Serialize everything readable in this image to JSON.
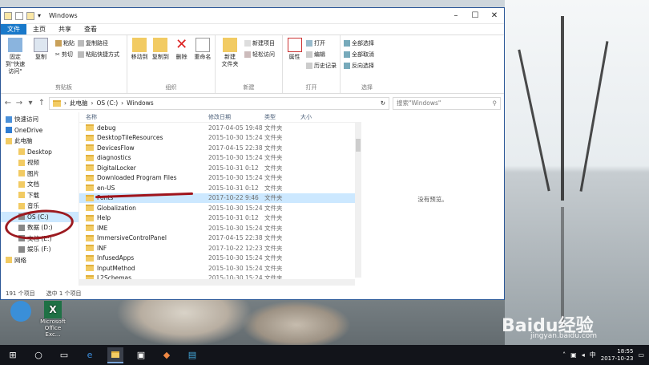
{
  "window": {
    "title": "Windows"
  },
  "tabs": [
    "文件",
    "主页",
    "共享",
    "查看"
  ],
  "ribbon": {
    "clipboard": {
      "pin": "固定到\"快速访问\"",
      "copy": "复制",
      "paste": "粘贴",
      "cut": "剪切",
      "copy_path": "复制路径",
      "paste_shortcut": "粘贴快捷方式",
      "label": "剪贴板"
    },
    "organize": {
      "move_to": "移动到",
      "copy_to": "复制到",
      "delete": "删除",
      "rename": "重命名",
      "label": "组织"
    },
    "new": {
      "new_folder": "新建\n文件夹",
      "new_item": "新建项目",
      "easy_access": "轻松访问",
      "label": "新建"
    },
    "open": {
      "properties": "属性",
      "open": "打开",
      "edit": "编辑",
      "history": "历史记录",
      "label": "打开"
    },
    "select": {
      "select_all": "全部选择",
      "select_none": "全部取消",
      "invert": "反向选择",
      "label": "选择"
    }
  },
  "address": {
    "path": [
      "此电脑",
      "OS (C:)",
      "Windows"
    ],
    "search_placeholder": "搜索\"Windows\""
  },
  "nav": [
    {
      "label": "快速访问",
      "sub": false,
      "icon": "star-icon"
    },
    {
      "label": "OneDrive",
      "sub": false,
      "icon": "cloud-icon"
    },
    {
      "label": "此电脑",
      "sub": false,
      "icon": "computer-icon"
    },
    {
      "label": "Desktop",
      "sub": true,
      "icon": "folder-icon"
    },
    {
      "label": "视频",
      "sub": true,
      "icon": "video-icon"
    },
    {
      "label": "图片",
      "sub": true,
      "icon": "picture-icon"
    },
    {
      "label": "文档",
      "sub": true,
      "icon": "document-icon"
    },
    {
      "label": "下载",
      "sub": true,
      "icon": "download-icon"
    },
    {
      "label": "音乐",
      "sub": true,
      "icon": "music-icon"
    },
    {
      "label": "OS (C:)",
      "sub": true,
      "icon": "drive-icon",
      "selected": true
    },
    {
      "label": "数据 (D:)",
      "sub": true,
      "icon": "drive-icon"
    },
    {
      "label": "文档 (E:)",
      "sub": true,
      "icon": "drive-icon"
    },
    {
      "label": "娱乐 (F:)",
      "sub": true,
      "icon": "drive-icon"
    },
    {
      "label": "网络",
      "sub": false,
      "icon": "network-icon"
    }
  ],
  "columns": {
    "name": "名称",
    "date": "修改日期",
    "type": "类型",
    "size": "大小"
  },
  "files": [
    {
      "name": "debug",
      "date": "2017-04-05 19:48",
      "type": "文件夹"
    },
    {
      "name": "DesktopTileResources",
      "date": "2015-10-30 15:24",
      "type": "文件夹"
    },
    {
      "name": "DevicesFlow",
      "date": "2017-04-15 22:38",
      "type": "文件夹"
    },
    {
      "name": "diagnostics",
      "date": "2015-10-30 15:24",
      "type": "文件夹"
    },
    {
      "name": "DigitalLocker",
      "date": "2015-10-31 0:12",
      "type": "文件夹"
    },
    {
      "name": "Downloaded Program Files",
      "date": "2015-10-30 15:24",
      "type": "文件夹"
    },
    {
      "name": "en-US",
      "date": "2015-10-31 0:12",
      "type": "文件夹"
    },
    {
      "name": "Fonts",
      "date": "2017-10-22 9:46",
      "type": "文件夹",
      "selected": true
    },
    {
      "name": "Globalization",
      "date": "2015-10-30 15:24",
      "type": "文件夹"
    },
    {
      "name": "Help",
      "date": "2015-10-31 0:12",
      "type": "文件夹"
    },
    {
      "name": "IME",
      "date": "2015-10-30 15:24",
      "type": "文件夹"
    },
    {
      "name": "ImmersiveControlPanel",
      "date": "2017-04-15 22:38",
      "type": "文件夹"
    },
    {
      "name": "INF",
      "date": "2017-10-22 12:23",
      "type": "文件夹"
    },
    {
      "name": "InfusedApps",
      "date": "2015-10-30 15:24",
      "type": "文件夹"
    },
    {
      "name": "InputMethod",
      "date": "2015-10-30 15:24",
      "type": "文件夹"
    },
    {
      "name": "L2Schemas",
      "date": "2015-10-30 15:24",
      "type": "文件夹"
    }
  ],
  "preview": "没有预览。",
  "status": {
    "count": "191 个项目",
    "selected": "选中 1 个项目"
  },
  "desktop_icons": [
    {
      "label": "",
      "icon": "network-globe-icon"
    },
    {
      "label": "Microsoft\nOffice Exc...",
      "icon": "excel-icon"
    }
  ],
  "tray": {
    "time": "18:55",
    "date": "2017-10-23"
  },
  "watermark": {
    "logo": "Baidu经验",
    "url": "jingyan.baidu.com"
  }
}
